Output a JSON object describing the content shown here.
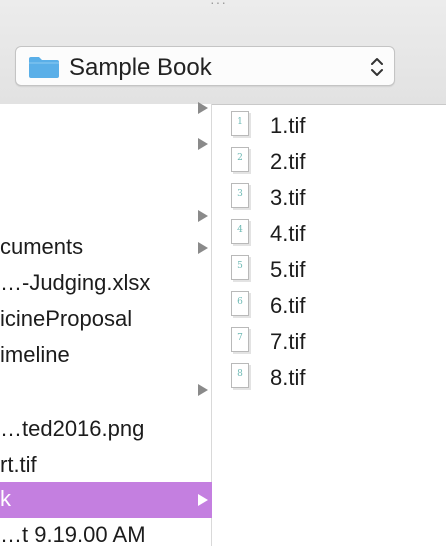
{
  "window": {
    "title_dots": "···",
    "path_popup": {
      "label": "Sample Book",
      "icon": "folder-icon",
      "folder_color": "#5aafe8"
    }
  },
  "left_column": {
    "items": [
      {
        "label": "",
        "has_arrow": true
      },
      {
        "label": "",
        "has_arrow": true
      },
      {
        "label": "",
        "has_arrow": true
      },
      {
        "label": "cuments",
        "has_arrow": true
      },
      {
        "label": "…-Judging.xlsx",
        "has_arrow": false
      },
      {
        "label": "icineProposal",
        "has_arrow": false
      },
      {
        "label": "imeline",
        "has_arrow": false
      },
      {
        "label": "",
        "has_arrow": true
      },
      {
        "label": "…ted2016.png",
        "has_arrow": false
      },
      {
        "label": "rt.tif",
        "has_arrow": false
      },
      {
        "label": "k",
        "has_arrow": true,
        "selected": true
      },
      {
        "label": "…t 9.19.00 AM",
        "has_arrow": false
      }
    ],
    "selection_color": "#c47fe0"
  },
  "right_column": {
    "files": [
      {
        "name": "1.tif",
        "thumb": "1"
      },
      {
        "name": "2.tif",
        "thumb": "2"
      },
      {
        "name": "3.tif",
        "thumb": "3"
      },
      {
        "name": "4.tif",
        "thumb": "4"
      },
      {
        "name": "5.tif",
        "thumb": "5"
      },
      {
        "name": "6.tif",
        "thumb": "6"
      },
      {
        "name": "7.tif",
        "thumb": "7"
      },
      {
        "name": "8.tif",
        "thumb": "8"
      }
    ]
  }
}
